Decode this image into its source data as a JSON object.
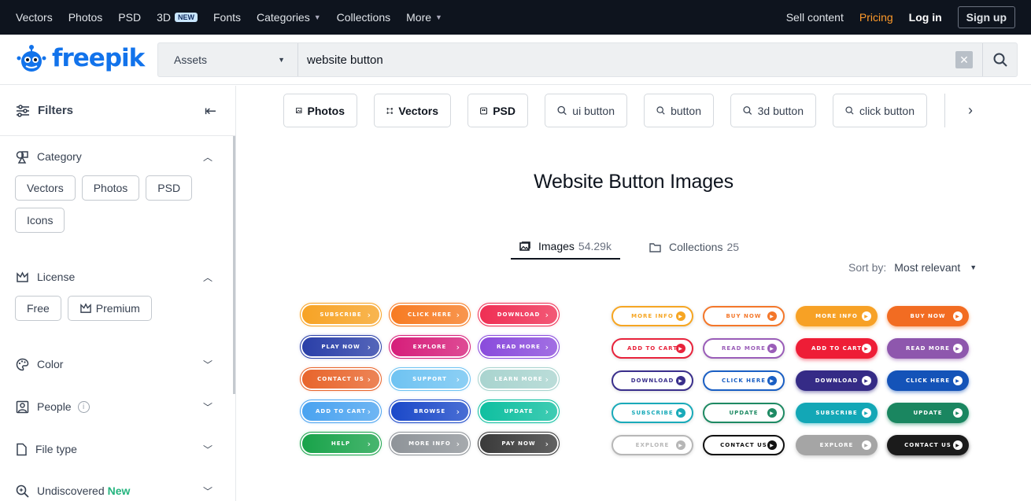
{
  "topnav": {
    "items": [
      "Vectors",
      "Photos",
      "PSD",
      "3D",
      "Fonts",
      "Categories",
      "Collections",
      "More"
    ],
    "new_badge": "NEW",
    "sell": "Sell content",
    "pricing": "Pricing",
    "login": "Log in",
    "signup": "Sign up"
  },
  "logo": {
    "text": "freepik"
  },
  "search": {
    "scope": "Assets",
    "query": "website button",
    "clear_icon": "close-icon",
    "submit_icon": "search-icon"
  },
  "sidebar": {
    "title": "Filters",
    "sections": {
      "category": {
        "title": "Category",
        "chips": [
          "Vectors",
          "Photos",
          "PSD",
          "Icons"
        ]
      },
      "license": {
        "title": "License",
        "chips": [
          "Free",
          "Premium"
        ]
      },
      "color": {
        "title": "Color"
      },
      "people": {
        "title": "People"
      },
      "filetype": {
        "title": "File type"
      },
      "undiscovered": {
        "title": "Undiscovered",
        "new": "New"
      }
    }
  },
  "tags": [
    "Photos",
    "Vectors",
    "PSD",
    "ui button",
    "button",
    "3d button",
    "click button"
  ],
  "main": {
    "title": "Website Button Images",
    "tabs": [
      {
        "label": "Images",
        "count": "54.29k"
      },
      {
        "label": "Collections",
        "count": "25"
      }
    ],
    "sort_label": "Sort by:",
    "sort_value": "Most relevant"
  },
  "card1": {
    "buttons": [
      [
        "SUBSCRIBE",
        "CLICK HERE",
        "DOWNLOAD"
      ],
      [
        "PLAY NOW",
        "EXPLORE",
        "READ MORE"
      ],
      [
        "CONTACT US",
        "SUPPORT",
        "LEARN MORE"
      ],
      [
        "ADD TO CART",
        "BROWSE",
        "UPDATE"
      ],
      [
        "HELP",
        "MORE INFO",
        "PAY NOW"
      ]
    ],
    "colors": [
      [
        "#f7a325",
        "#f77b22",
        "#ef2f54"
      ],
      [
        "#2a3fa8",
        "#d61e7a",
        "#8a4bdc"
      ],
      [
        "#e8652c",
        "#6fc3f2",
        "#a9d4cf"
      ],
      [
        "#4aa3f0",
        "#1b49c9",
        "#0fbfa0"
      ],
      [
        "#19a34a",
        "#8f9499",
        "#3a3a3a"
      ]
    ]
  },
  "card2": {
    "outline": [
      [
        "MORE INFO",
        "BUY NOW"
      ],
      [
        "ADD TO CART",
        "READ MORE"
      ],
      [
        "DOWNLOAD",
        "CLICK HERE"
      ],
      [
        "SUBSCRIBE",
        "UPDATE"
      ],
      [
        "EXPLORE",
        "CONTACT US"
      ]
    ],
    "filled": [
      [
        "MORE INFO",
        "BUY NOW"
      ],
      [
        "ADD TO CART",
        "READ MORE"
      ],
      [
        "DOWNLOAD",
        "CLICK HERE"
      ],
      [
        "SUBSCRIBE",
        "UPDATE"
      ],
      [
        "EXPLORE",
        "CONTACT US"
      ]
    ],
    "outline_colors": [
      [
        "#f6a623",
        "#f4772a"
      ],
      [
        "#e8233c",
        "#9a5db8"
      ],
      [
        "#3a2f8c",
        "#1a5fc4"
      ],
      [
        "#19aab9",
        "#1e8a63"
      ],
      [
        "#b7b7b7",
        "#111111"
      ]
    ],
    "filled_colors": [
      [
        "#f7a125",
        "#f26c22"
      ],
      [
        "#ee1d36",
        "#8e57ad"
      ],
      [
        "#352b86",
        "#1453b8"
      ],
      [
        "#13a7b6",
        "#1a8660"
      ],
      [
        "#a5a5a5",
        "#1b1b1b"
      ]
    ]
  }
}
